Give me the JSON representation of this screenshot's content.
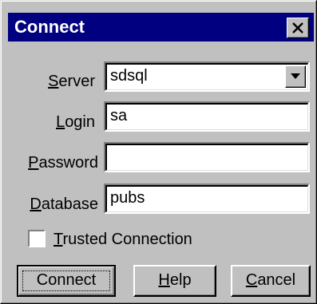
{
  "dialog": {
    "title": "Connect"
  },
  "fields": {
    "server": {
      "label_first": "S",
      "label_rest": "erver",
      "value": "sdsql"
    },
    "login": {
      "label_first": "L",
      "label_rest": "ogin",
      "value": "sa"
    },
    "password": {
      "label_first": "P",
      "label_rest": "assword",
      "value": ""
    },
    "database": {
      "label_first": "D",
      "label_rest": "atabase",
      "value": "pubs"
    }
  },
  "options": {
    "trusted_first": "T",
    "trusted_rest": "rusted Connection",
    "trusted_checked": false
  },
  "buttons": {
    "connect": "Connect",
    "help_first": "H",
    "help_rest": "elp",
    "cancel_first": "C",
    "cancel_rest": "ancel"
  },
  "icons": {
    "close": "close-icon",
    "dropdown": "chevron-down-icon"
  },
  "colors": {
    "titlebar": "#000080",
    "face": "#c0c0c0"
  }
}
